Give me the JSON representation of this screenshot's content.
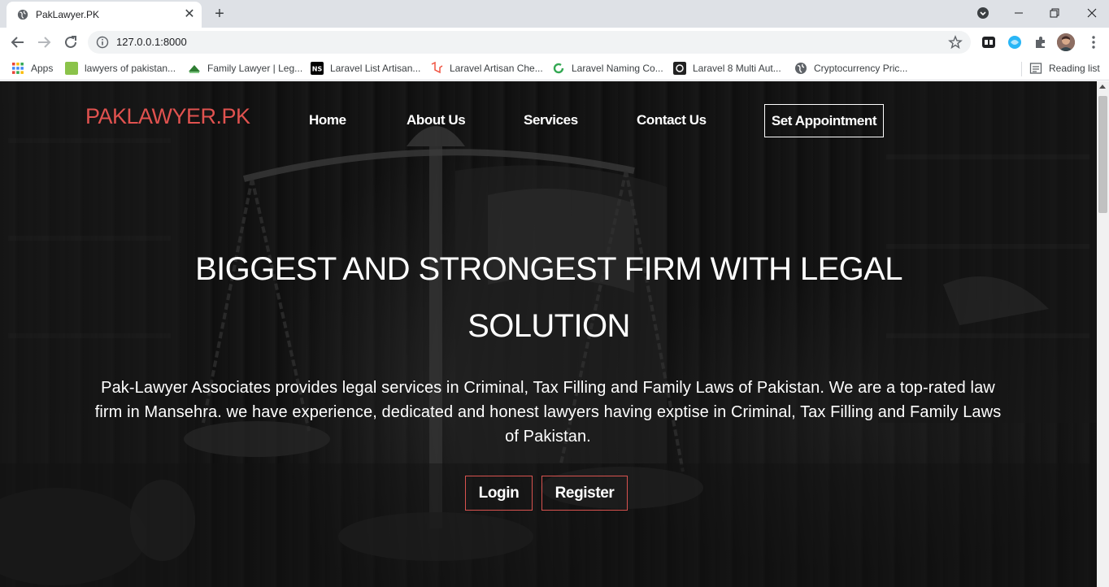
{
  "browser": {
    "tab_title": "PakLawyer.PK",
    "tab_close": "✕",
    "new_tab": "+",
    "url": "127.0.0.1:8000",
    "bookmarks": [
      {
        "label": "Apps",
        "icon": "apps-grid-icon",
        "color": "#4285f4"
      },
      {
        "label": "lawyers of pakistan...",
        "icon": "ask-icon",
        "color": "#8bc34a"
      },
      {
        "label": "Family Lawyer | Leg...",
        "icon": "family-lawyer-icon",
        "color": "#2e7d32"
      },
      {
        "label": "Laravel List Artisan...",
        "icon": "ns-icon",
        "color": "#000000"
      },
      {
        "label": "Laravel Artisan Che...",
        "icon": "laravel-icon",
        "color": "#f05340"
      },
      {
        "label": "Laravel Naming Co...",
        "icon": "refresh-green-icon",
        "color": "#34a853"
      },
      {
        "label": "Laravel 8 Multi Aut...",
        "icon": "dark-square-icon",
        "color": "#222222"
      },
      {
        "label": "Cryptocurrency Pric...",
        "icon": "globe-icon",
        "color": "#5f6368"
      }
    ],
    "reading_list": "Reading list"
  },
  "site": {
    "brand": "PAKLAWYER.PK",
    "brand_color": "#e0524f",
    "nav": {
      "home": "Home",
      "about": "About Us",
      "services": "Services",
      "contact": "Contact Us",
      "appointment": "Set Appointment"
    },
    "hero": {
      "title_line1": "BIGGEST AND STRONGEST FIRM WITH LEGAL",
      "title_line2": "SOLUTION",
      "text": "Pak-Lawyer Associates provides legal services in Criminal, Tax Filling and Family Laws of Pakistan. We are a top-rated law firm in Mansehra. we have experience, dedicated and honest lawyers having exptise in Criminal, Tax Filling and Family Laws of Pakistan.",
      "login": "Login",
      "register": "Register"
    }
  }
}
